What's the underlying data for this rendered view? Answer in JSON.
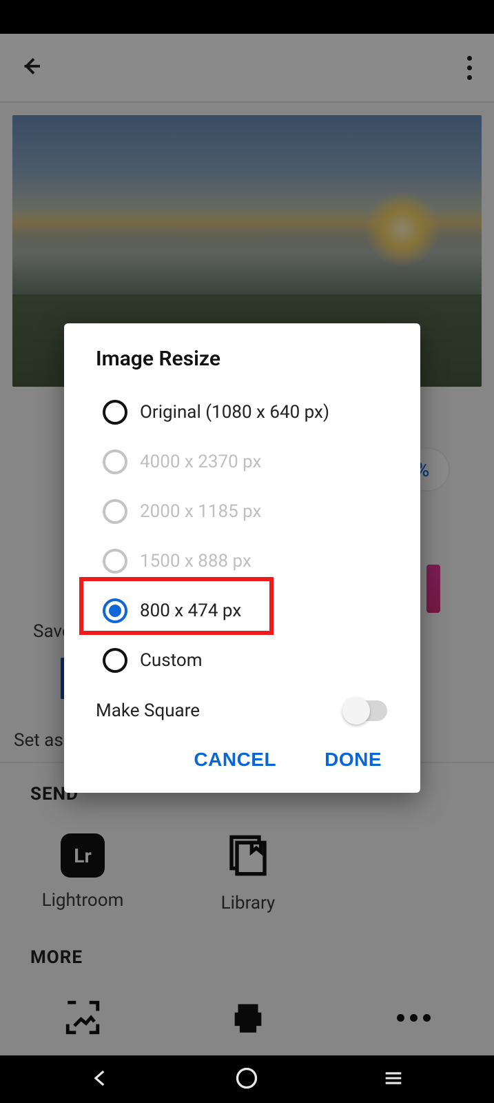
{
  "header": {
    "back_icon": "arrow-left",
    "overflow_icon": "more-vertical"
  },
  "percent_chip": "%",
  "background": {
    "save_label": "Save",
    "set_as_label": "Set as p",
    "send_section": "SEND",
    "send_items": [
      {
        "icon_text": "Lr",
        "label": "Lightroom"
      },
      {
        "icon": "library",
        "label": "Library"
      }
    ],
    "more_section": "MORE"
  },
  "dialog": {
    "title": "Image Resize",
    "options": [
      {
        "label": "Original (1080 x 640 px)",
        "state": "unselected",
        "enabled": true
      },
      {
        "label": "4000 x 2370 px",
        "state": "unselected",
        "enabled": false
      },
      {
        "label": "2000 x 1185 px",
        "state": "unselected",
        "enabled": false
      },
      {
        "label": "1500 x 888 px",
        "state": "unselected",
        "enabled": false
      },
      {
        "label": "800 x 474 px",
        "state": "selected",
        "enabled": true
      },
      {
        "label": "Custom",
        "state": "unselected",
        "enabled": true
      }
    ],
    "make_square_label": "Make Square",
    "make_square_on": false,
    "cancel": "CANCEL",
    "done": "DONE"
  },
  "nav": {
    "back": "nav-back",
    "home": "nav-home",
    "recents": "nav-recents"
  }
}
